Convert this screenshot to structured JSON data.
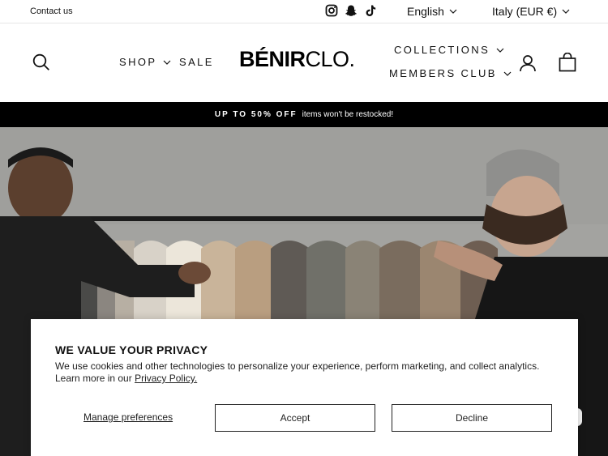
{
  "utility": {
    "contact": "Contact us",
    "social_icons": [
      "instagram-icon",
      "snapchat-icon",
      "tiktok-icon"
    ],
    "language": "English",
    "country": "Italy (EUR €)"
  },
  "header": {
    "logo_bold": "BÉNIR",
    "logo_light": "CLO.",
    "nav_left": [
      {
        "label": "SHOP",
        "has_dropdown": true
      },
      {
        "label": "SALE",
        "has_dropdown": false
      }
    ],
    "nav_right": [
      {
        "label": "COLLECTIONS",
        "has_dropdown": true
      },
      {
        "label": "MEMBERS CLUB",
        "has_dropdown": true
      }
    ],
    "icons": [
      "search-icon",
      "account-icon",
      "cart-icon"
    ]
  },
  "announcement": {
    "strong": "UP TO 50% OFF",
    "text": "items won't be restocked!",
    "background": "#000000"
  },
  "cookie": {
    "title": "WE VALUE YOUR PRIVACY",
    "body": "We use cookies and other technologies to personalize your experience, perform marketing, and collect analytics. Learn more in our",
    "link": "Privacy Policy.",
    "manage": "Manage preferences",
    "accept": "Accept",
    "decline": "Decline"
  }
}
